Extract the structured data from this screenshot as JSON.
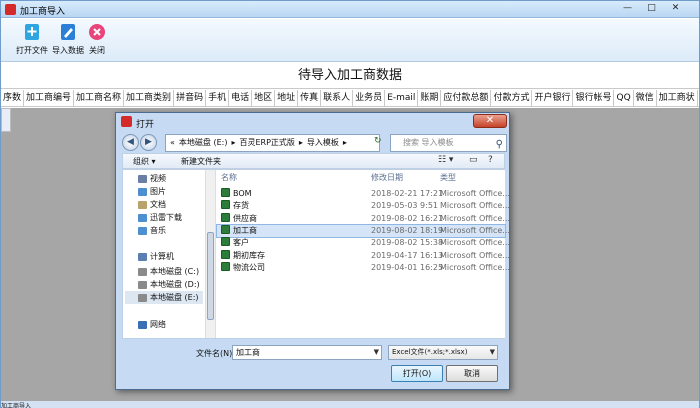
{
  "app": {
    "title": "加工商导入",
    "window_buttons": {
      "minimize": "—",
      "maximize": "□",
      "close": "✕"
    }
  },
  "toolbar": {
    "buttons": [
      {
        "label": "打开文件",
        "icon": "open-file-icon",
        "color": "#2ea4e0"
      },
      {
        "label": "导入数据",
        "icon": "import-data-icon",
        "color": "#2b7fd6"
      },
      {
        "label": "关闭",
        "icon": "close-circle-icon",
        "color": "#e8457b"
      }
    ]
  },
  "heading": "待导入加工商数据",
  "columns": [
    "序数",
    "加工商编号",
    "加工商名称",
    "加工商类别",
    "拼音码",
    "手机",
    "电话",
    "地区",
    "地址",
    "传真",
    "联系人",
    "业务员",
    "E-mail",
    "账期",
    "应付款总额",
    "付款方式",
    "开户银行",
    "银行帐号",
    "QQ",
    "微信",
    "加工商状"
  ],
  "dialog": {
    "title": "打开",
    "close_label": "✕",
    "address_parts": [
      "«",
      "本地磁盘 (E:)",
      "▸",
      "百灵ERP正式版",
      "▸",
      "导入模板",
      "▸"
    ],
    "search_placeholder": "搜索 导入模板",
    "organize": "组织 ▾",
    "new_folder": "新建文件夹",
    "tree": [
      {
        "label": "视频",
        "icon": "video-folder-icon",
        "color": "#6b7fa6"
      },
      {
        "label": "图片",
        "icon": "pictures-folder-icon",
        "color": "#4d8fcf"
      },
      {
        "label": "文档",
        "icon": "documents-folder-icon",
        "color": "#b9a36c"
      },
      {
        "label": "迅雷下载",
        "icon": "download-folder-icon",
        "color": "#4d8fcf"
      },
      {
        "label": "音乐",
        "icon": "music-folder-icon",
        "color": "#4d8fcf"
      },
      {
        "label": "计算机",
        "icon": "computer-icon",
        "color": "#5a7fb0"
      },
      {
        "label": "本地磁盘 (C:)",
        "icon": "drive-icon",
        "color": "#8a8a8a"
      },
      {
        "label": "本地磁盘 (D:)",
        "icon": "drive-icon",
        "color": "#8a8a8a"
      },
      {
        "label": "本地磁盘 (E:)",
        "icon": "drive-icon",
        "color": "#8a8a8a"
      },
      {
        "label": "网络",
        "icon": "network-icon",
        "color": "#3a6fb5"
      }
    ],
    "file_headers": {
      "name": "名称",
      "date": "修改日期",
      "type": "类型"
    },
    "files": [
      {
        "name": "BOM",
        "date": "2018-02-21 17:21",
        "type": "Microsoft Office..."
      },
      {
        "name": "存货",
        "date": "2019-05-03 9:51",
        "type": "Microsoft Office..."
      },
      {
        "name": "供应商",
        "date": "2019-08-02 16:21",
        "type": "Microsoft Office..."
      },
      {
        "name": "加工商",
        "date": "2019-08-02 18:19",
        "type": "Microsoft Office..."
      },
      {
        "name": "客户",
        "date": "2019-08-02 15:38",
        "type": "Microsoft Office..."
      },
      {
        "name": "期初库存",
        "date": "2019-04-17 16:13",
        "type": "Microsoft Office..."
      },
      {
        "name": "物流公司",
        "date": "2019-04-01 16:25",
        "type": "Microsoft Office..."
      }
    ],
    "selected_file_index": 3,
    "filename_label": "文件名(N):",
    "filename_value": "加工商",
    "filetype_value": "Excel文件(*.xls;*.xlsx)",
    "open_label": "打开(O)",
    "cancel_label": "取消"
  },
  "status": {
    "text": "加工商导入"
  }
}
